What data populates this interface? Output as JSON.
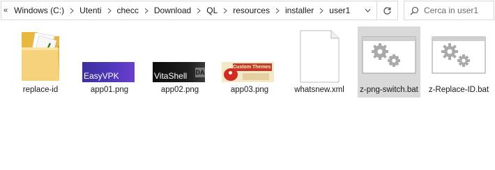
{
  "address_bar": {
    "crumbs": [
      "Windows (C:)",
      "Utenti",
      "checc",
      "Download",
      "QL",
      "resources",
      "installer",
      "user1"
    ]
  },
  "search": {
    "placeholder": "Cerca in user1"
  },
  "files": [
    {
      "name": "replace-id",
      "kind": "folder"
    },
    {
      "name": "app01.png",
      "kind": "image",
      "thumb_text": "EasyVPK"
    },
    {
      "name": "app02.png",
      "kind": "image",
      "thumb_text": "VitaShell"
    },
    {
      "name": "app03.png",
      "kind": "image",
      "thumb_text": "Custom Themes Manager"
    },
    {
      "name": "whatsnew.xml",
      "kind": "document"
    },
    {
      "name": "z-png-switch.bat",
      "kind": "batch",
      "selected": true
    },
    {
      "name": "z-Replace-ID.bat",
      "kind": "batch"
    }
  ],
  "colors": {
    "selection": "#d9d9d9",
    "folder": "#f1c653"
  }
}
